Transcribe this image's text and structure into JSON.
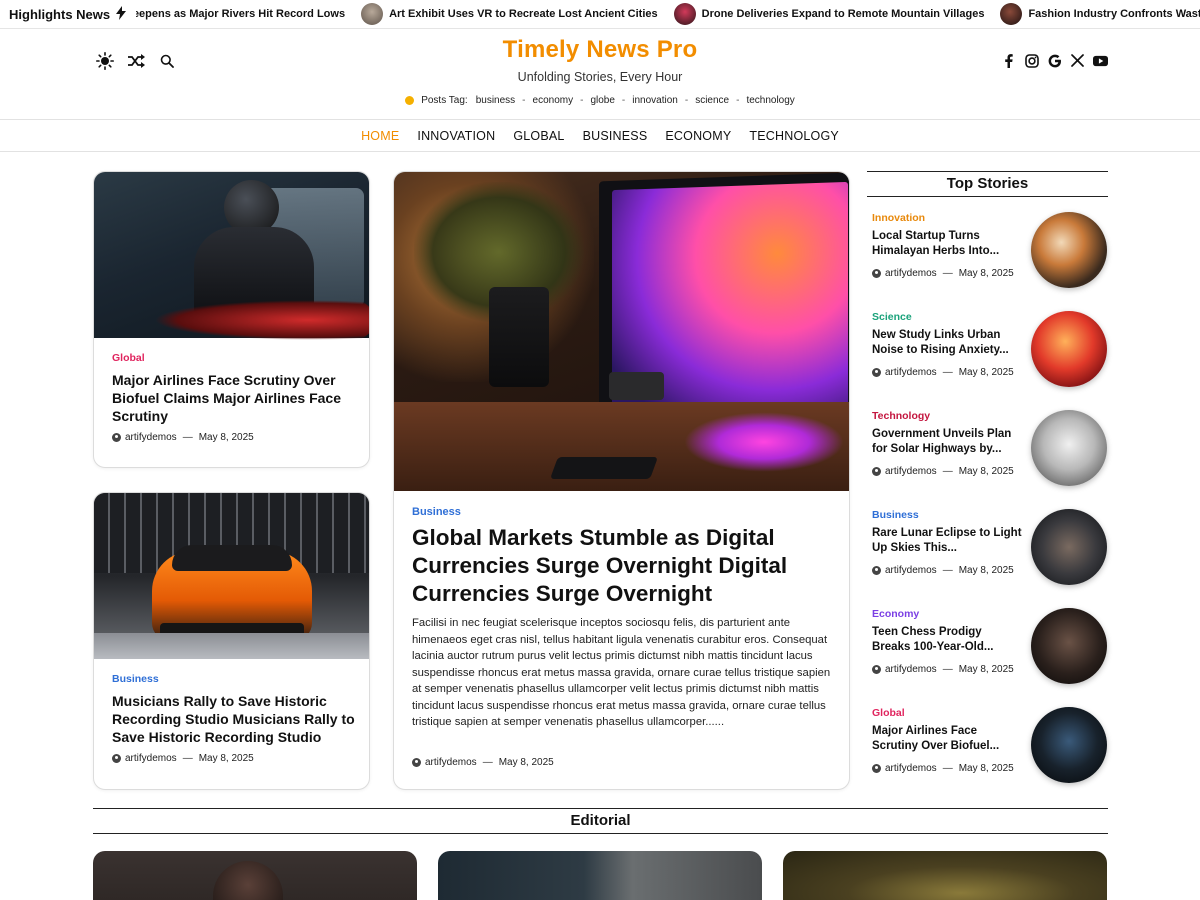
{
  "ticker": {
    "label": "Highlights News",
    "items": [
      {
        "title": "Deepens as Major Rivers Hit Record Lows",
        "has_thumb": false
      },
      {
        "title": "Art Exhibit Uses VR to Recreate Lost Ancient Cities",
        "has_thumb": true
      },
      {
        "title": "Drone Deliveries Expand to Remote Mountain Villages",
        "has_thumb": true
      },
      {
        "title": "Fashion Industry Confronts Waste Crisis",
        "has_thumb": true
      }
    ]
  },
  "header": {
    "title": "Timely News Pro",
    "tagline": "Unfolding Stories, Every Hour",
    "tags_label": "Posts Tag:",
    "tags": [
      "business",
      "economy",
      "globe",
      "innovation",
      "science",
      "technology"
    ],
    "left_icons": [
      "sun-icon",
      "shuffle-icon",
      "search-icon"
    ],
    "social_icons": [
      "facebook-icon",
      "instagram-icon",
      "google-icon",
      "x-icon",
      "youtube-icon"
    ]
  },
  "nav": {
    "items": [
      "HOME",
      "INNOVATION",
      "GLOBAL",
      "BUSINESS",
      "ECONOMY",
      "TECHNOLOGY"
    ],
    "active": "HOME"
  },
  "colors": {
    "accent": "#f28d00",
    "global": "#e0245e",
    "business": "#2f6fd6",
    "science": "#1aa27a",
    "technology": "#c4163f",
    "economy": "#7b3fe4",
    "innovation": "#e8890c"
  },
  "cards": {
    "left_top": {
      "category": "Global",
      "title": "Major Airlines Face Scrutiny Over Biofuel Claims Major Airlines Face Scrutiny",
      "author": "artifydemos",
      "date": "May 8, 2025",
      "sep": "—"
    },
    "left_bottom": {
      "category": "Business",
      "title": "Musicians Rally to Save Historic Recording Studio Musicians Rally to Save Historic Recording Studio",
      "author": "artifydemos",
      "date": "May 8, 2025",
      "sep": "—"
    },
    "featured": {
      "category": "Business",
      "title": "Global Markets Stumble as Digital Currencies Surge Overnight Digital Currencies Surge Overnight",
      "excerpt": "Facilisi in nec feugiat scelerisque inceptos sociosqu felis, dis parturient ante himenaeos eget cras nisl, tellus habitant ligula venenatis curabitur eros. Consequat lacinia auctor rutrum purus velit lectus primis dictumst nibh mattis tincidunt lacus suspendisse rhoncus erat metus massa gravida, ornare curae tellus tristique sapien at semper venenatis phasellus ullamcorper velit lectus primis dictumst nibh mattis tincidunt lacus suspendisse rhoncus erat metus massa gravida, ornare curae tellus tristique sapien at semper venenatis phasellus ullamcorper......",
      "author": "artifydemos",
      "date": "May 8, 2025",
      "sep": "—"
    }
  },
  "sidebar": {
    "heading": "Top Stories",
    "items": [
      {
        "category": "Innovation",
        "cat_key": "innovation",
        "title": "Local Startup Turns Himalayan Herbs Into...",
        "author": "artifydemos",
        "date": "May 8, 2025",
        "sep": "—"
      },
      {
        "category": "Science",
        "cat_key": "science",
        "title": "New Study Links Urban Noise to Rising Anxiety...",
        "author": "artifydemos",
        "date": "May 8, 2025",
        "sep": "—"
      },
      {
        "category": "Technology",
        "cat_key": "technology",
        "title": "Government Unveils Plan for Solar Highways by...",
        "author": "artifydemos",
        "date": "May 8, 2025",
        "sep": "—"
      },
      {
        "category": "Business",
        "cat_key": "business",
        "title": "Rare Lunar Eclipse to Light Up Skies This...",
        "author": "artifydemos",
        "date": "May 8, 2025",
        "sep": "—"
      },
      {
        "category": "Economy",
        "cat_key": "economy",
        "title": "Teen Chess Prodigy Breaks 100-Year-Old...",
        "author": "artifydemos",
        "date": "May 8, 2025",
        "sep": "—"
      },
      {
        "category": "Global",
        "cat_key": "global",
        "title": "Major Airlines Face Scrutiny Over Biofuel...",
        "author": "artifydemos",
        "date": "May 8, 2025",
        "sep": "—"
      }
    ]
  },
  "editorial": {
    "heading": "Editorial"
  }
}
